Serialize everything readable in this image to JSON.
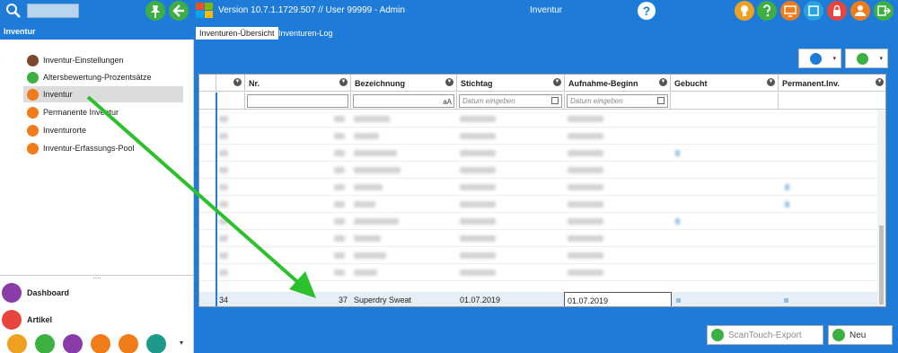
{
  "header": {
    "version_text": "Version 10.7.1.1729.507  //  User 99999 - Admin",
    "title": "Inventur",
    "help_label": "?",
    "icons": [
      "search-icon",
      "pin-icon",
      "back-arrow-icon",
      "windows-logo-icon",
      "help-icon",
      "lightbulb-icon",
      "question-icon",
      "monitor-icon",
      "screenshot-icon",
      "lock-icon",
      "user-icon",
      "exit-icon"
    ]
  },
  "sidebar": {
    "title": "Inventur",
    "items": [
      {
        "label": "Inventur-Einstellungen",
        "icon": "gear-icon"
      },
      {
        "label": "Altersbewertung-Prozentsätze",
        "icon": "list-icon"
      },
      {
        "label": "Inventur",
        "icon": "inventory-icon"
      },
      {
        "label": "Permanente Inventur",
        "icon": "inventory-icon"
      },
      {
        "label": "Inventurorte",
        "icon": "inventory-icon"
      },
      {
        "label": "Inventur-Erfassungs-Pool",
        "icon": "inventory-icon"
      }
    ],
    "separator": "....",
    "bottom": [
      {
        "label": "Dashboard",
        "icon": "dashboard-icon"
      },
      {
        "label": "Artikel",
        "icon": "shirt-icon"
      }
    ],
    "quick_icons": [
      "note-icon",
      "truck-icon",
      "sale-icon",
      "person-icon",
      "document-search-icon",
      "window-icon"
    ],
    "more_label": "▾"
  },
  "tabs": [
    {
      "label": "Inventuren-Übersicht"
    },
    {
      "label": "Inventuren-Log"
    }
  ],
  "toolbar": {
    "print_icon": "printer-icon",
    "export_icon": "export-icon",
    "dropdown_arrow": "▾"
  },
  "grid": {
    "columns": [
      {
        "label": "Nr."
      },
      {
        "label": "Bezeichnung"
      },
      {
        "label": "Stichtag"
      },
      {
        "label": "Aufnahme-Beginn"
      },
      {
        "label": "Gebucht"
      },
      {
        "label": "Permanent.Inv."
      }
    ],
    "filter_placeholders": {
      "stichtag": "Datum eingeben",
      "aufnahme": "Datum eingeben",
      "aa": "aA"
    },
    "filter_icon": "▼",
    "selected_row": {
      "id": "34",
      "nr": "37",
      "bezeichnung": "Superdry Sweat",
      "stichtag": "01.07.2019",
      "aufnahme": "01.07.2019"
    }
  },
  "buttons": {
    "scantouch_export": "ScanTouch-Export",
    "neu": "Neu"
  },
  "colors": {
    "accent": "#1e7bd8",
    "green": "#3db043",
    "orange": "#f07b1a"
  }
}
